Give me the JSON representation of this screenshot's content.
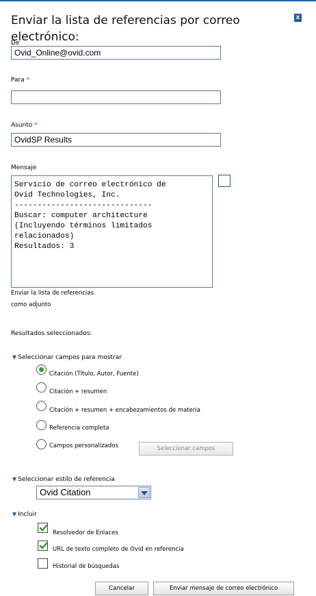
{
  "dialog": {
    "title": "Enviar la lista de referencias por correo electrónico:",
    "close_label": "x"
  },
  "from": {
    "label": "De",
    "value": "Ovid_Online@ovid.com"
  },
  "to": {
    "label": "Para",
    "required": "*",
    "value": ""
  },
  "subject": {
    "label": "Asunto",
    "required": "*",
    "value": "OvidSP Results"
  },
  "message": {
    "label": "Mensaje",
    "lines": [
      "Servicio de correo electrónico de",
      "Ovid Technologies, Inc.",
      "------------------------------",
      "Buscar: computer architecture",
      "(Incluyendo términos limitados",
      "relacionados)",
      "Resultados: 3"
    ]
  },
  "attachment": {
    "label_line1": "Enviar la lista de referencias",
    "label_line2": "como adjunto",
    "checked": false
  },
  "selected_results": {
    "label": "Resultados seleccionados:"
  },
  "fields_section": {
    "label": "Seleccionar campos para mostrar",
    "options": [
      {
        "label": "Citación (Título, Autor, Fuente)",
        "selected": true
      },
      {
        "label": "Citación + resumen",
        "selected": false
      },
      {
        "label": "Citación + resumen + encabezamientos de materia",
        "selected": false
      },
      {
        "label": "Referencia completa",
        "selected": false
      },
      {
        "label": "Campos personalizados",
        "selected": false
      }
    ],
    "select_fields_button": "Seleccionar campos"
  },
  "style_section": {
    "label": "Seleccionar estilo de referencia",
    "selected": "Ovid Citation"
  },
  "include_section": {
    "label": "Incluir",
    "options": [
      {
        "label": "Resolvedor de Enlaces",
        "checked": true
      },
      {
        "label": "URL de texto completo de Ovid en referencia",
        "checked": true
      },
      {
        "label": "Historial de búsquedas",
        "checked": false
      }
    ]
  },
  "actions": {
    "cancel": "Cancelar",
    "send": "Enviar mensaje de correo electrónico"
  },
  "colors": {
    "accent": "#2a5aa0",
    "radio_selected": "#3a9a3a",
    "required": "#dd2222"
  }
}
